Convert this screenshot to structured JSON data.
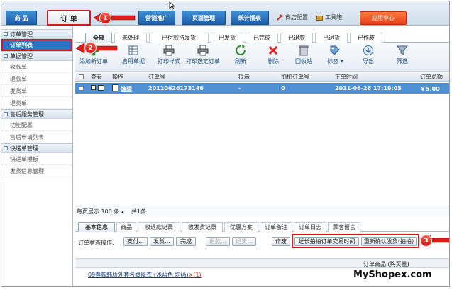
{
  "topnav": {
    "products": "商 品",
    "orders": "订 单",
    "marketing": "营销推广",
    "pages": "页面管理",
    "reports": "统计报表",
    "store_config": "商店配置",
    "toolbox": "工具箱",
    "app_center": "应用中心"
  },
  "sidebar": {
    "groups": [
      {
        "title": "订单管理",
        "items": [
          "订单列表"
        ]
      },
      {
        "title": "单据管理",
        "items": [
          "收款单",
          "退款单",
          "发货单",
          "退货单"
        ]
      },
      {
        "title": "售后服务管理",
        "items": [
          "功能配置",
          "售后申请列表"
        ]
      },
      {
        "title": "快递单管理",
        "items": [
          "快递单模板",
          "发货信息管理"
        ]
      }
    ]
  },
  "tabs": [
    "全部",
    "未处理",
    "已付款待发货",
    "已发货",
    "已完成",
    "已退款",
    "已退货",
    "已作废"
  ],
  "toolbar": [
    "添加新订单",
    "启用单据",
    "打印样式",
    "打印选定订单",
    "刷新",
    "删除",
    "回收站",
    "标签",
    "导出",
    "筛选"
  ],
  "table": {
    "headers": {
      "view": "查看",
      "action": "操作",
      "order_no": "订单号",
      "hint": "提示",
      "paipai_no": "拍拍订单号",
      "order_time": "下单时间",
      "total": "订单总额"
    },
    "row": {
      "edit": "编辑",
      "order_no": "20110626173146",
      "hint": "-",
      "paipai_no": "0",
      "order_time": "2011-06-26 17:19:05",
      "total": "￥5.00"
    }
  },
  "pager": {
    "per_page": "每页显示 100 条",
    "total": "共1条"
  },
  "detail_tabs": [
    "基本信息",
    "商品",
    "收退款记录",
    "收发货记录",
    "优惠方案",
    "订单备注",
    "订单日志",
    "顾客留言"
  ],
  "ops": {
    "label": "订单状态操作:",
    "pay": "支付...",
    "ship": "发货...",
    "complete": "完成",
    "refund": "退款...",
    "return": "退货...",
    "void": "作废",
    "extend": "延长拍拍订单交易时间",
    "reconfirm": "重新确认发货(拍拍)"
  },
  "goods": {
    "header": "订单商品 (购买量)",
    "item": "09春款韩版外套名媛風衣 (浅蓝色 均码)",
    "qty": "×(1)"
  },
  "callouts": [
    "1",
    "2",
    "3"
  ],
  "watermark": "MyShopex.com",
  "colors": {
    "accent": "#2b74c4",
    "highlight": "#d8161b",
    "selected_row": "#4f8fd3"
  }
}
